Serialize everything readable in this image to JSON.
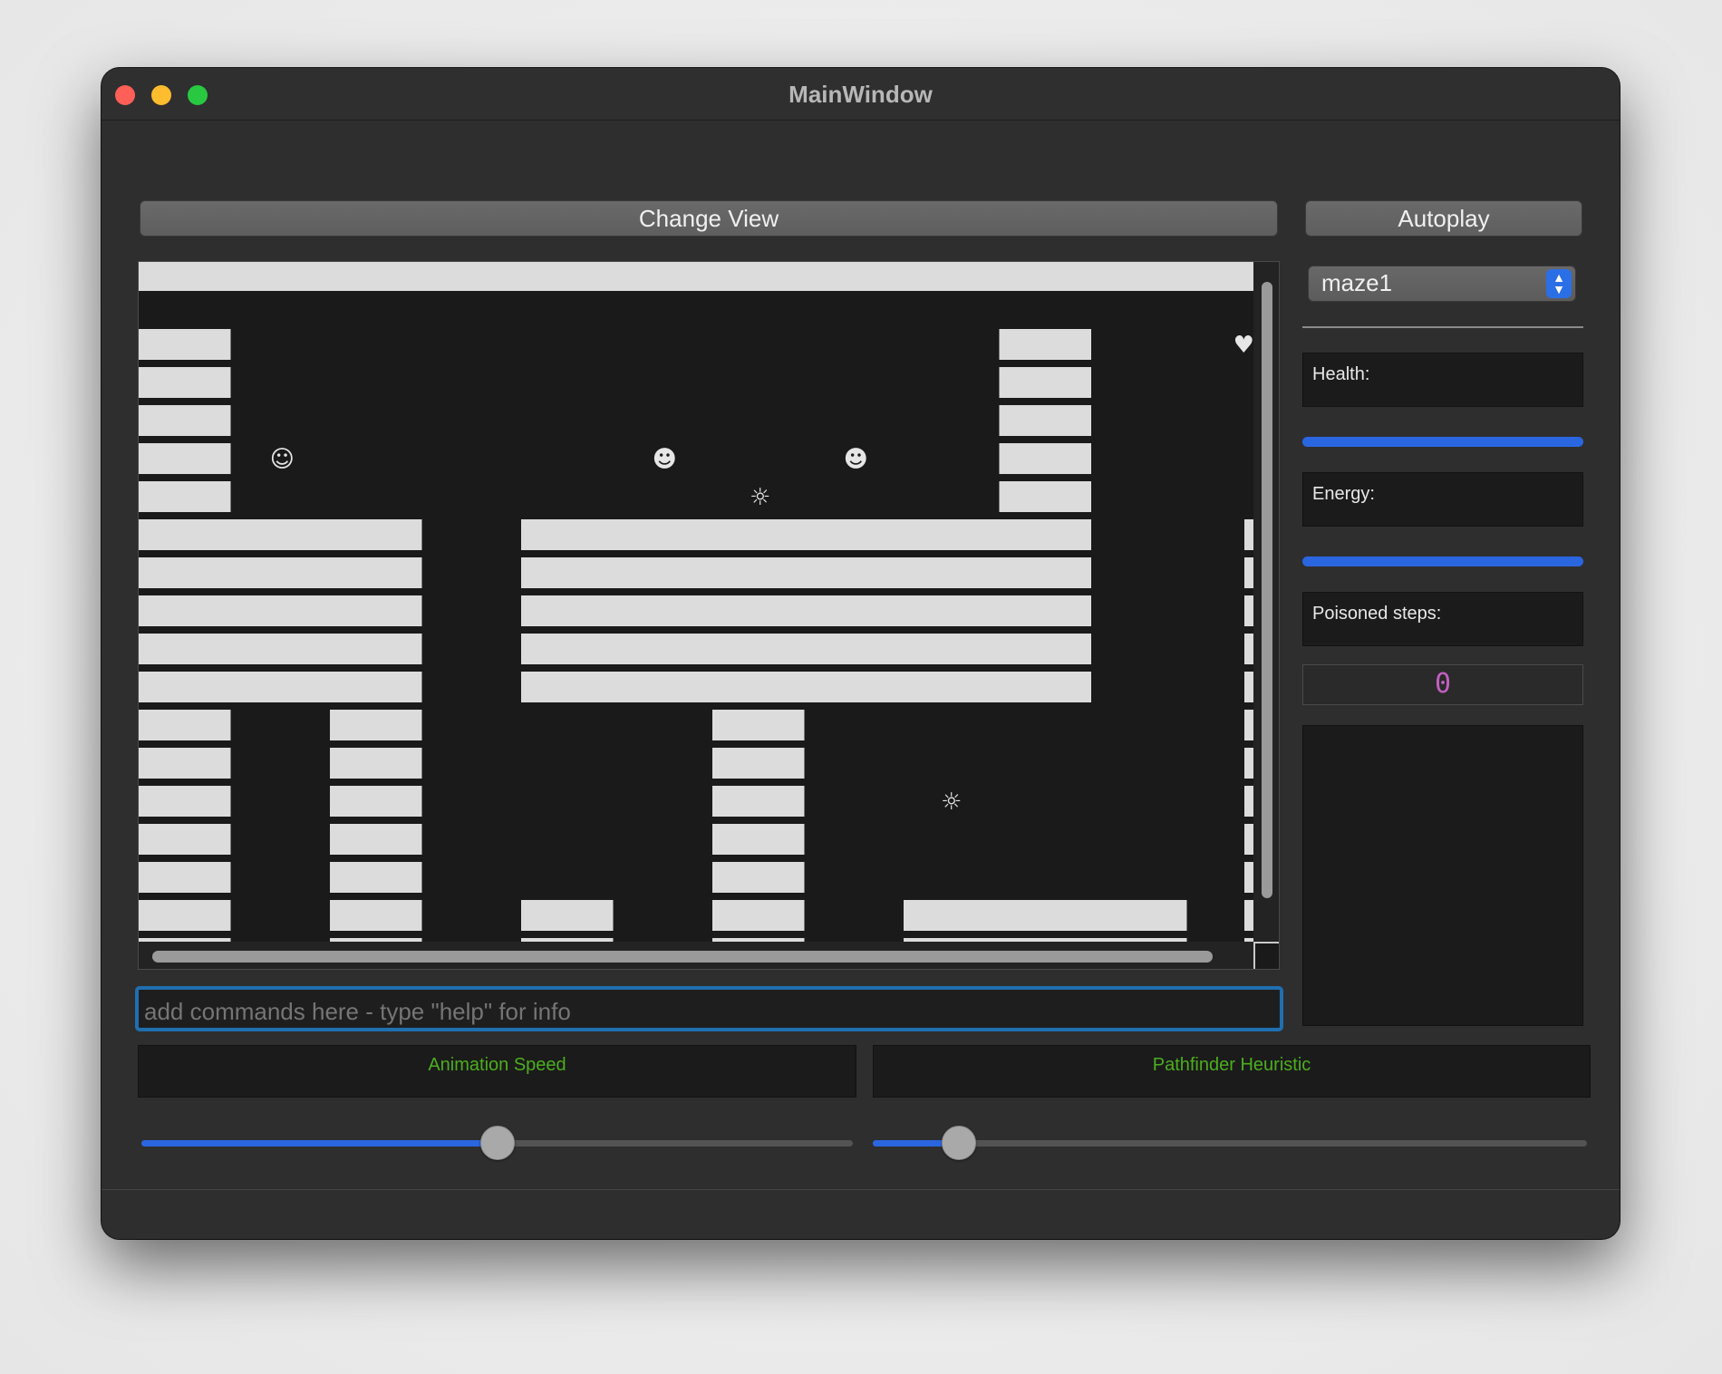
{
  "window": {
    "title": "MainWindow"
  },
  "toolbar": {
    "change_view_label": "Change View",
    "autoplay_label": "Autoplay"
  },
  "maze_select": {
    "selected": "maze1"
  },
  "stats": {
    "health_label": "Health:",
    "health_fraction": 1.0,
    "energy_label": "Energy:",
    "energy_fraction": 1.0,
    "poisoned_label": "Poisoned steps:",
    "poisoned_value": "0"
  },
  "command": {
    "placeholder": "add commands here - type \"help\" for info"
  },
  "controls": {
    "animation_speed_label": "Animation Speed",
    "animation_speed_fraction": 0.5,
    "heuristic_label": "Pathfinder Heuristic",
    "heuristic_fraction": 0.12
  },
  "maze": {
    "columns": 12,
    "rows": 18,
    "walls": [
      [
        0,
        0,
        1,
        1,
        1,
        1,
        1,
        1,
        1,
        1,
        1,
        1
      ],
      [
        1,
        0,
        0,
        0,
        0,
        0,
        0,
        0,
        0,
        1,
        0,
        0
      ],
      [
        1,
        0,
        0,
        0,
        0,
        0,
        0,
        0,
        0,
        1,
        0,
        0
      ],
      [
        1,
        0,
        0,
        0,
        0,
        0,
        0,
        0,
        0,
        1,
        0,
        0
      ],
      [
        1,
        0,
        0,
        0,
        0,
        0,
        0,
        0,
        0,
        1,
        0,
        0
      ],
      [
        1,
        0,
        0,
        0,
        0,
        0,
        0,
        0,
        0,
        1,
        0,
        0
      ],
      [
        1,
        1,
        1,
        0,
        1,
        1,
        1,
        1,
        1,
        1,
        0,
        1
      ],
      [
        1,
        1,
        1,
        0,
        1,
        1,
        1,
        1,
        1,
        1,
        0,
        1
      ],
      [
        1,
        1,
        1,
        0,
        1,
        1,
        1,
        1,
        1,
        1,
        0,
        1
      ],
      [
        1,
        1,
        1,
        0,
        1,
        1,
        1,
        1,
        1,
        1,
        0,
        1
      ],
      [
        1,
        1,
        1,
        0,
        1,
        1,
        1,
        1,
        1,
        1,
        0,
        1
      ],
      [
        1,
        0,
        1,
        0,
        0,
        0,
        1,
        0,
        0,
        0,
        0,
        1
      ],
      [
        1,
        0,
        1,
        0,
        0,
        0,
        1,
        0,
        0,
        0,
        0,
        1
      ],
      [
        1,
        0,
        1,
        0,
        0,
        0,
        1,
        0,
        0,
        0,
        0,
        1
      ],
      [
        1,
        0,
        1,
        0,
        0,
        0,
        1,
        0,
        0,
        0,
        0,
        1
      ],
      [
        1,
        0,
        1,
        0,
        0,
        0,
        1,
        0,
        0,
        0,
        0,
        1
      ],
      [
        1,
        0,
        1,
        0,
        1,
        0,
        1,
        0,
        1,
        1,
        1,
        1
      ],
      [
        1,
        0,
        1,
        0,
        1,
        0,
        1,
        0,
        1,
        1,
        1,
        1
      ]
    ],
    "entities": [
      {
        "name": "protagonist-smiley-icon",
        "symbol": "☺",
        "col": 1,
        "row": 4
      },
      {
        "name": "enemy-smiley-icon",
        "symbol": "☻",
        "col": 5,
        "row": 4
      },
      {
        "name": "enemy-smiley-icon",
        "symbol": "☻",
        "col": 7,
        "row": 4
      },
      {
        "name": "poison-enemy-icon",
        "symbol": "☼",
        "col": 6,
        "row": 5
      },
      {
        "name": "poison-enemy-icon",
        "symbol": "☼",
        "col": 8,
        "row": 13
      },
      {
        "name": "health-pack-heart-icon",
        "symbol": "♥",
        "col": 11,
        "row": 1
      }
    ]
  },
  "colors": {
    "accent": "#2a66e0",
    "label_green": "#4cae1c",
    "wall": "#dcdcdc",
    "floor": "#1a1a1a"
  }
}
